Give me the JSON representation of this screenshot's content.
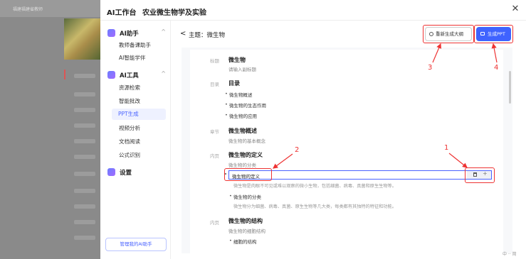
{
  "background": {
    "top_label": "福建福建省教师"
  },
  "modal": {
    "title": "AI工作台",
    "subtitle": "农业微生物学及实验",
    "close": "✕"
  },
  "nav": {
    "group1": "AI助手",
    "group1_items": [
      "教师备课助手",
      "AI智能学伴"
    ],
    "group2": "AI工具",
    "group2_items": [
      "资源检索",
      "智能批改",
      "PPT生成",
      "视频分析",
      "文档阅读",
      "公式识别"
    ],
    "active_item": "PPT生成",
    "settings": "设置",
    "manage_button": "管理我的AI助手"
  },
  "header": {
    "back": "<",
    "topic": "主题：微生物",
    "regen_button": "重新生成大纲",
    "generate_button": "生成PPT"
  },
  "annotations": [
    "1",
    "2",
    "3",
    "4"
  ],
  "outline": {
    "title_tag": "标题",
    "title": "微生物",
    "title_sub": "请输入副标题",
    "toc_tag": "目录",
    "toc": "目录",
    "toc_items": [
      "微生物概述",
      "微生物的生态作用",
      "微生物的应用"
    ],
    "chapter_tag": "章节",
    "chapter": "微生物概述",
    "chapter_sub": "微生物的基本概念",
    "content_tag": "内页",
    "content_title": "微生物的定义",
    "content_sub": "微生物的分类",
    "edit_value": "微生物的定义",
    "point1_desc": "微生物是肉眼不可见或难以观察的微小生物，包括细菌、病毒、真菌和原生生物等。",
    "point2": "微生物的分类",
    "point2_desc": "微生物分为细菌、病毒、真菌、原生生物等几大类，每类都有其独特的特征和功能。",
    "content2_tag": "内页",
    "content2_title": "微生物的结构",
    "content2_sub": "微生物的细胞结构",
    "content2_point": "细胞的结构"
  },
  "corner_text": "中 ·· 简"
}
